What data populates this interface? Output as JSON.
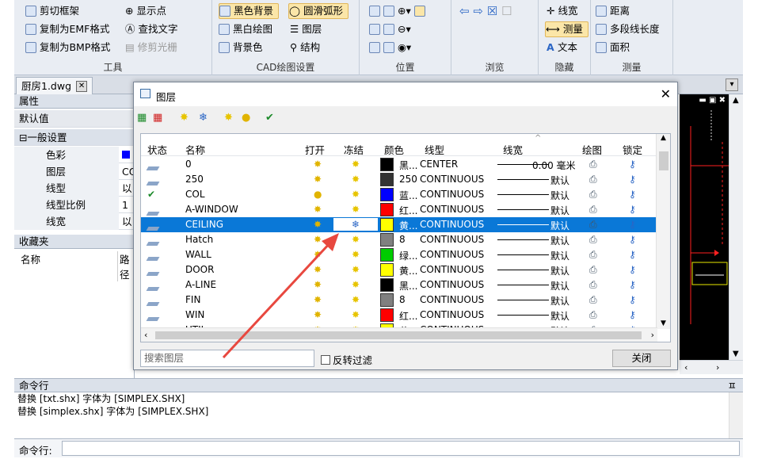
{
  "ribbon": {
    "tools": {
      "label": "工具",
      "items": [
        "剪切框架",
        "复制为EMF格式",
        "复制为BMP格式"
      ],
      "items2": [
        "显示点",
        "查找文字",
        "修剪光栅"
      ]
    },
    "cad": {
      "label": "CAD绘图设置",
      "items": [
        "黑色背景",
        "黑白绘图",
        "背景色"
      ],
      "items2": [
        "圆滑弧形",
        "图层",
        "结构"
      ]
    },
    "position": {
      "label": "位置"
    },
    "browse": {
      "label": "浏览"
    },
    "hidden": {
      "label": "隐藏",
      "items": [
        "线宽",
        "测量",
        "文本"
      ]
    },
    "measure": {
      "label": "测量",
      "items": [
        "距离",
        "多段线长度",
        "面积"
      ]
    }
  },
  "doc_tab": "厨房1.dwg",
  "props": {
    "title": "属性",
    "default": "默认值",
    "group": "一般设置",
    "rows": [
      {
        "k": "色彩",
        "v": ""
      },
      {
        "k": "图层",
        "v": "CO"
      },
      {
        "k": "线型",
        "v": "以"
      },
      {
        "k": "线型比例",
        "v": "1"
      },
      {
        "k": "线宽",
        "v": "以"
      }
    ]
  },
  "favorites": {
    "title": "收藏夹",
    "col1": "名称",
    "col2": "路径"
  },
  "dialog": {
    "title": "图层",
    "headers": [
      "状态",
      "名称",
      "打开",
      "冻结",
      "颜色",
      "线型",
      "线宽",
      "绘图",
      "锁定"
    ],
    "layers": [
      {
        "name": "0",
        "color": "#000000",
        "color_label": "黑...",
        "linetype": "CENTER",
        "lw": "0.00 毫米",
        "status": "layer"
      },
      {
        "name": "250",
        "color": "#333333",
        "color_label": "250",
        "linetype": "CONTINUOUS",
        "lw": "默认",
        "status": "layer"
      },
      {
        "name": "COL",
        "color": "#0000ff",
        "color_label": "蓝...",
        "linetype": "CONTINUOUS",
        "lw": "默认",
        "status": "check"
      },
      {
        "name": "A-WINDOW",
        "color": "#ff0000",
        "color_label": "红...",
        "linetype": "CONTINUOUS",
        "lw": "默认",
        "status": "layer"
      },
      {
        "name": "CEILING",
        "color": "#ffff00",
        "color_label": "黄...",
        "linetype": "CONTINUOUS",
        "lw": "默认",
        "status": "layer"
      },
      {
        "name": "Hatch",
        "color": "#808080",
        "color_label": "8",
        "linetype": "CONTINUOUS",
        "lw": "默认",
        "status": "layer"
      },
      {
        "name": "WALL",
        "color": "#00cc00",
        "color_label": "绿...",
        "linetype": "CONTINUOUS",
        "lw": "默认",
        "status": "layer"
      },
      {
        "name": "DOOR",
        "color": "#ffff00",
        "color_label": "黄...",
        "linetype": "CONTINUOUS",
        "lw": "默认",
        "status": "layer"
      },
      {
        "name": "A-LINE",
        "color": "#000000",
        "color_label": "黑...",
        "linetype": "CONTINUOUS",
        "lw": "默认",
        "status": "layer"
      },
      {
        "name": "FIN",
        "color": "#808080",
        "color_label": "8",
        "linetype": "CONTINUOUS",
        "lw": "默认",
        "status": "layer"
      },
      {
        "name": "WIN",
        "color": "#ff0000",
        "color_label": "红...",
        "linetype": "CONTINUOUS",
        "lw": "默认",
        "status": "layer"
      },
      {
        "name": "UTIL",
        "color": "#ffff00",
        "color_label": "黄...",
        "linetype": "CONTINUOUS",
        "lw": "默认",
        "status": "layer"
      }
    ],
    "selected": "CEILING",
    "search_placeholder": "搜索图层",
    "invert_label": "反转过滤",
    "close_label": "关闭"
  },
  "command": {
    "title": "命令行",
    "lines": [
      "替换 [txt.shx] 字体为 [SIMPLEX.SHX]",
      "替换 [simplex.shx] 字体为 [SIMPLEX.SHX]"
    ],
    "input_label": "命令行:"
  },
  "colors": {
    "selection": "#0a78d7",
    "arrow": "#e8483f"
  }
}
